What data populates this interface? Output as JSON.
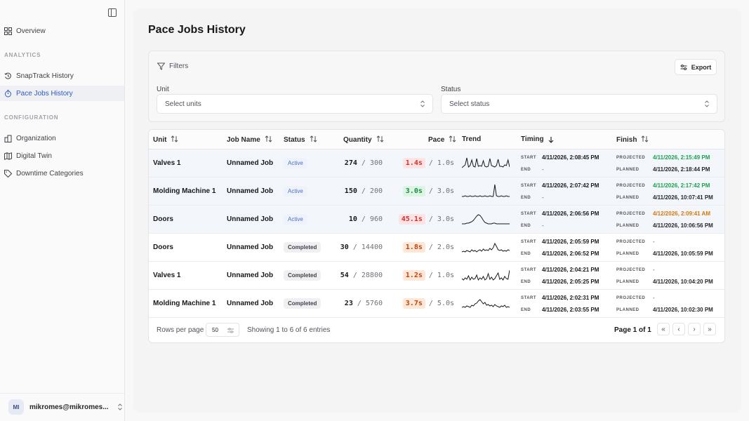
{
  "sidebar": {
    "overview": "Overview",
    "analytics_label": "ANALYTICS",
    "snaptrack": "SnapTrack History",
    "pace_jobs": "Pace Jobs History",
    "configuration_label": "CONFIGURATION",
    "organization": "Organization",
    "digital_twin": "Digital Twin",
    "downtime": "Downtime Categories",
    "user_initials": "MI",
    "user_email": "mikromes@mikromes..."
  },
  "page": {
    "title": "Pace Jobs History"
  },
  "filters": {
    "title": "Filters",
    "export_label": "Export",
    "unit_label": "Unit",
    "unit_placeholder": "Select units",
    "status_label": "Status",
    "status_placeholder": "Select status"
  },
  "table": {
    "headers": {
      "unit": "Unit",
      "job_name": "Job Name",
      "status": "Status",
      "quantity": "Quantity",
      "pace": "Pace",
      "trend": "Trend",
      "timing": "Timing",
      "finish": "Finish"
    },
    "labels": {
      "start": "START",
      "end": "END",
      "projected": "PROJECTED",
      "planned": "PLANNED"
    },
    "rows": [
      {
        "unit": "Valves 1",
        "job": "Unnamed Job",
        "status": "Active",
        "qty_done": "274",
        "qty_total": "/ 300",
        "pace": "1.4s",
        "pace_target": "/ 1.0s",
        "pace_color": "red",
        "start": "4/11/2026, 2:08:45 PM",
        "end": "-",
        "projected": "4/11/2026, 2:15:49 PM",
        "projected_color": "green",
        "planned": "4/11/2026, 2:18:44 PM",
        "trend": [
          18,
          16,
          14,
          4,
          17,
          15,
          7,
          16,
          17,
          5,
          16,
          15,
          16,
          8,
          16,
          17,
          16,
          5,
          15,
          16,
          17,
          15,
          6,
          16,
          16,
          17,
          14,
          15,
          7,
          17
        ]
      },
      {
        "unit": "Molding Machine 1",
        "job": "Unnamed Job",
        "status": "Active",
        "qty_done": "150",
        "qty_total": "/ 200",
        "pace": "3.0s",
        "pace_target": "/ 3.0s",
        "pace_color": "green",
        "start": "4/11/2026, 2:07:42 PM",
        "end": "-",
        "projected": "4/11/2026, 2:17:42 PM",
        "projected_color": "green",
        "planned": "4/11/2026, 10:07:41 PM",
        "trend": [
          19,
          19,
          18,
          19,
          19,
          18,
          19,
          19,
          18,
          19,
          19,
          18,
          19,
          19,
          18,
          19,
          19,
          18,
          19,
          19,
          2,
          18,
          19,
          19,
          18,
          19,
          19,
          18,
          19,
          19
        ]
      },
      {
        "unit": "Doors",
        "job": "Unnamed Job",
        "status": "Active",
        "qty_done": "10",
        "qty_total": "/ 960",
        "pace": "45.1s",
        "pace_target": "/ 3.0s",
        "pace_color": "red",
        "start": "4/11/2026, 2:06:56 PM",
        "end": "-",
        "projected": "4/12/2026, 2:09:41 AM",
        "projected_color": "orange",
        "planned": "4/11/2026, 10:06:56 PM",
        "trend": [
          18,
          18,
          18,
          17,
          17,
          16,
          15,
          13,
          10,
          7,
          5,
          6,
          9,
          13,
          16,
          17,
          18,
          18,
          18,
          17,
          17,
          18,
          18,
          18,
          18,
          18,
          18,
          18,
          18,
          18
        ]
      },
      {
        "unit": "Doors",
        "job": "Unnamed Job",
        "status": "Completed",
        "qty_done": "30",
        "qty_total": "/ 14400",
        "pace": "1.8s",
        "pace_target": "/ 2.0s",
        "pace_color": "orange",
        "start": "4/11/2026, 2:05:59 PM",
        "end": "4/11/2026, 2:06:52 PM",
        "projected": "-",
        "projected_color": "none",
        "planned": "4/11/2026, 10:05:59 PM",
        "trend": [
          18,
          17,
          18,
          16,
          17,
          18,
          15,
          17,
          16,
          18,
          16,
          15,
          17,
          14,
          16,
          15,
          16,
          13,
          15,
          12,
          6,
          10,
          15,
          16,
          15,
          17,
          16,
          17,
          15,
          16
        ]
      },
      {
        "unit": "Valves 1",
        "job": "Unnamed Job",
        "status": "Completed",
        "qty_done": "54",
        "qty_total": "/ 28800",
        "pace": "1.2s",
        "pace_target": "/ 1.0s",
        "pace_color": "orange",
        "start": "4/11/2026, 2:04:21 PM",
        "end": "4/11/2026, 2:05:25 PM",
        "projected": "-",
        "projected_color": "none",
        "planned": "4/11/2026, 10:04:20 PM",
        "trend": [
          16,
          18,
          15,
          17,
          12,
          18,
          14,
          17,
          16,
          11,
          18,
          15,
          17,
          13,
          18,
          16,
          9,
          17,
          14,
          18,
          16,
          12,
          8,
          17,
          15,
          18,
          13,
          16,
          17,
          4
        ]
      },
      {
        "unit": "Molding Machine 1",
        "job": "Unnamed Job",
        "status": "Completed",
        "qty_done": "23",
        "qty_total": "/ 5760",
        "pace": "3.7s",
        "pace_target": "/ 5.0s",
        "pace_color": "orange",
        "start": "4/11/2026, 2:02:31 PM",
        "end": "4/11/2026, 2:03:55 PM",
        "projected": "-",
        "projected_color": "none",
        "planned": "4/11/2026, 10:02:30 PM",
        "trend": [
          17,
          16,
          17,
          15,
          16,
          17,
          14,
          15,
          12,
          11,
          8,
          6,
          9,
          12,
          10,
          14,
          13,
          15,
          14,
          16,
          13,
          15,
          16,
          17,
          15,
          16,
          14,
          17,
          16,
          17
        ]
      }
    ]
  },
  "footer": {
    "rows_per_page_label": "Rows per page",
    "rows_per_page": "50",
    "showing": "Showing 1 to 6 of 6 entries",
    "page_info": "Page 1 of 1",
    "first": "«",
    "prev": "‹",
    "next": "›",
    "last": "»"
  },
  "colors": {
    "accent": "#2f59c2",
    "pace_red_bg": "#fde4e4",
    "pace_red_fg": "#d92d2d",
    "pace_green_bg": "#dcf5e3",
    "pace_green_fg": "#1a8a43",
    "pace_orange_bg": "#fde8d7",
    "pace_orange_fg": "#c2410c",
    "projected_green": "#16a34a",
    "projected_orange": "#d97706"
  }
}
